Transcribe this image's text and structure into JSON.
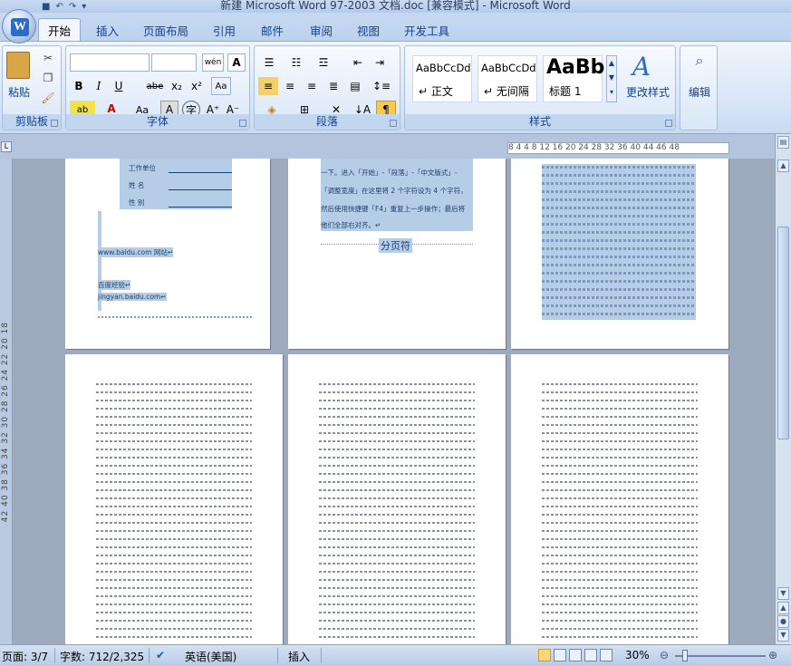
{
  "window": {
    "title": "新建 Microsoft Word 97-2003 文档.doc [兼容模式] - Microsoft Word"
  },
  "tabs": [
    "开始",
    "插入",
    "页面布局",
    "引用",
    "邮件",
    "审阅",
    "视图",
    "开发工具"
  ],
  "ribbon": {
    "clipboard": {
      "label": "剪贴板",
      "paste_label": "粘贴"
    },
    "font": {
      "label": "字体",
      "font_size_label": "wén",
      "format_buttons": [
        "B",
        "I",
        "U",
        "abe",
        "x₂",
        "x²",
        "Aa",
        "A",
        "A⁺",
        "A⁻"
      ]
    },
    "paragraph": {
      "label": "段落"
    },
    "styles": {
      "label": "样式",
      "items": [
        {
          "sample": "AaBbCcDd",
          "name": "↵ 正文"
        },
        {
          "sample": "AaBbCcDd",
          "name": "↵ 无间隔"
        },
        {
          "sample": "AaBb",
          "name": "标题 1"
        }
      ],
      "change_styles_label": "更改样式"
    },
    "editing": {
      "label": "编辑"
    }
  },
  "rulers": {
    "horizontal": "8  4     4  8  12 16 20 24 28 32 36 40 44 46 48",
    "vertical": "42 40 38 36 34 32 30 28 26 24 22 20 18"
  },
  "pages": {
    "page1": {
      "fields": [
        {
          "label": "工作单位",
          "value": "↵"
        },
        {
          "label": "姓    名",
          "value": "↵"
        },
        {
          "label": "性    别",
          "value": "↵"
        }
      ],
      "text1": "www.baidu.com 网站↵",
      "text2": "百度经验↵",
      "text3": "jingyan.baidu.com↵"
    },
    "page2": {
      "line1": "一下。进入「开始」-「段落」-「中文版式」-",
      "line2": "「调整宽度」在这里将 2 个字符设为 4 个字符，",
      "line3": "然后使用快捷键「F4」重复上一步操作；最后将",
      "line4": "他们全部右对齐。↵",
      "page_break": "分页符"
    }
  },
  "status": {
    "page": "页面: 3/7",
    "words": "字数: 712/2,325",
    "language": "英语(美国)",
    "mode": "插入",
    "zoom": "30%"
  }
}
